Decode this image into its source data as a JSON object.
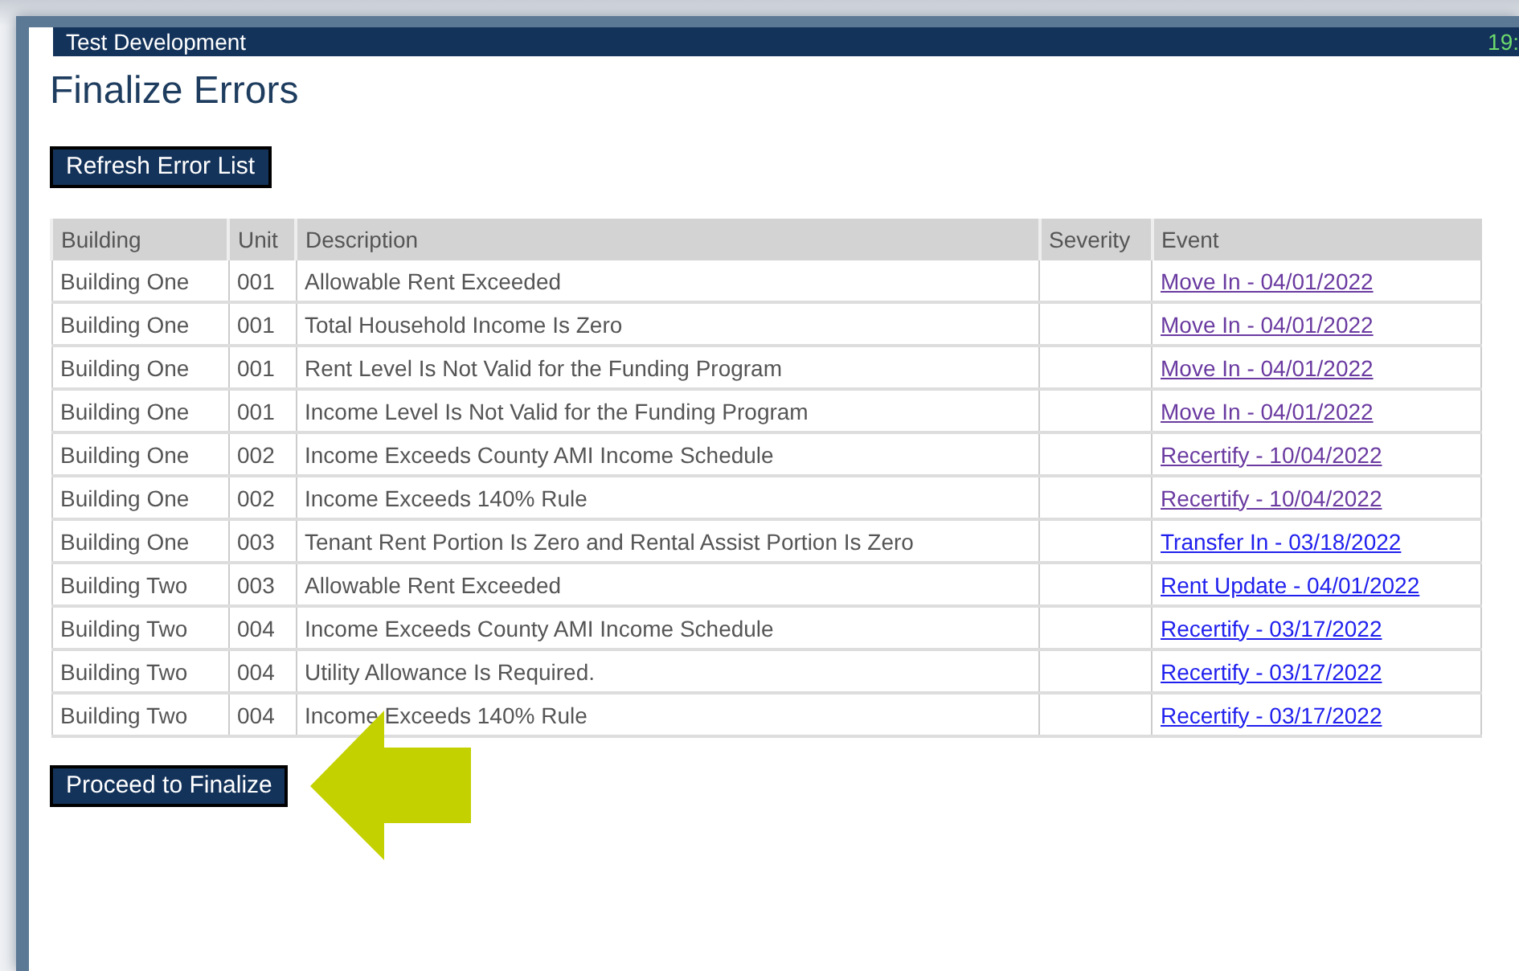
{
  "header": {
    "title": "Test Development",
    "clock": "19:"
  },
  "page_title": "Finalize Errors",
  "refresh_button": "Refresh Error List",
  "table": {
    "columns": [
      "Building",
      "Unit",
      "Description",
      "Severity",
      "Event"
    ],
    "rows": [
      {
        "building": "Building One",
        "unit": "001",
        "description": "Allowable Rent Exceeded",
        "event": "Move In - 04/01/2022",
        "visited": true
      },
      {
        "building": "Building One",
        "unit": "001",
        "description": "Total Household Income Is Zero",
        "event": "Move In - 04/01/2022",
        "visited": true
      },
      {
        "building": "Building One",
        "unit": "001",
        "description": "Rent Level Is Not Valid for the Funding Program",
        "event": "Move In - 04/01/2022",
        "visited": true
      },
      {
        "building": "Building One",
        "unit": "001",
        "description": "Income Level Is Not Valid for the Funding Program",
        "event": "Move In - 04/01/2022",
        "visited": true
      },
      {
        "building": "Building One",
        "unit": "002",
        "description": "Income Exceeds County AMI Income Schedule",
        "event": "Recertify - 10/04/2022",
        "visited": true
      },
      {
        "building": "Building One",
        "unit": "002",
        "description": "Income Exceeds 140% Rule",
        "event": "Recertify - 10/04/2022",
        "visited": true
      },
      {
        "building": "Building One",
        "unit": "003",
        "description": "Tenant Rent Portion Is Zero and Rental Assist Portion Is Zero",
        "event": "Transfer In - 03/18/2022",
        "visited": false
      },
      {
        "building": "Building Two",
        "unit": "003",
        "description": "Allowable Rent Exceeded",
        "event": "Rent Update - 04/01/2022",
        "visited": false
      },
      {
        "building": "Building Two",
        "unit": "004",
        "description": "Income Exceeds County AMI Income Schedule",
        "event": "Recertify - 03/17/2022",
        "visited": false
      },
      {
        "building": "Building Two",
        "unit": "004",
        "description": "Utility Allowance Is Required.",
        "event": "Recertify - 03/17/2022",
        "visited": false
      },
      {
        "building": "Building Two",
        "unit": "004",
        "description": "Income Exceeds 140% Rule",
        "event": "Recertify - 03/17/2022",
        "visited": false
      }
    ]
  },
  "proceed_button": "Proceed to Finalize"
}
